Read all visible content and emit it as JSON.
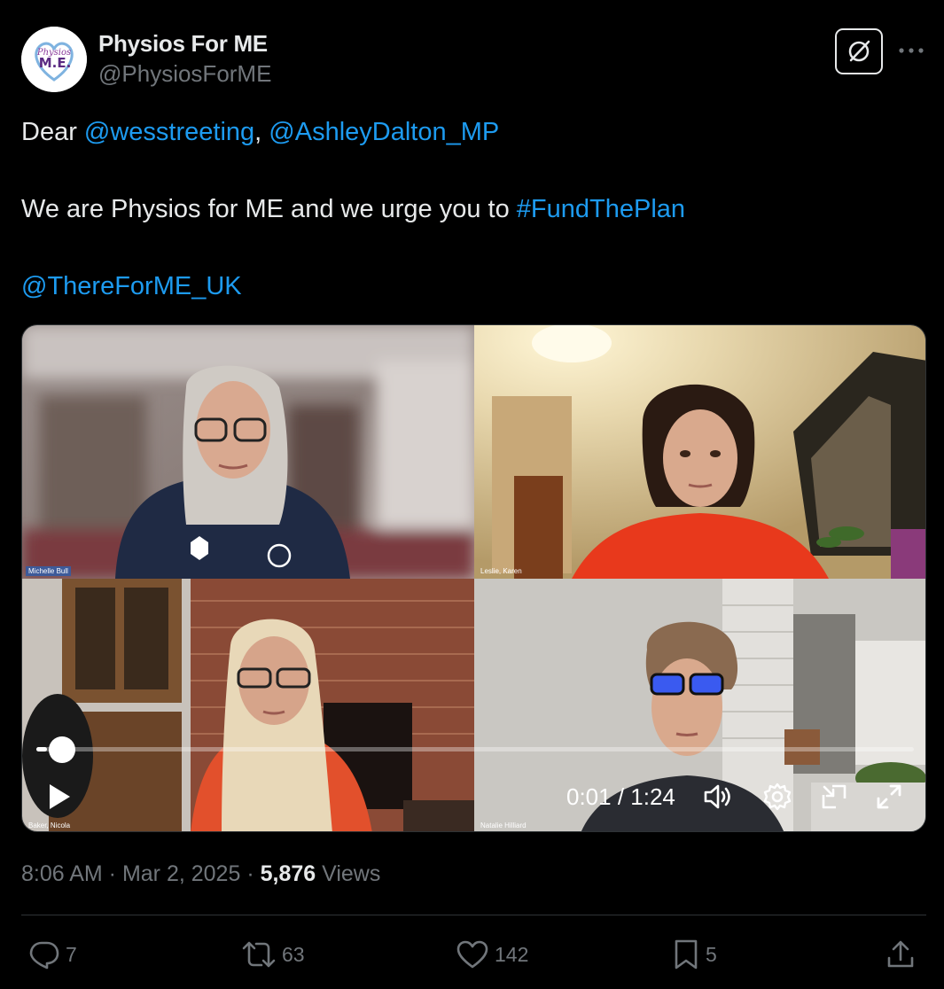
{
  "author": {
    "display_name": "Physios For ME",
    "handle": "@PhysiosForME",
    "avatar_text_top": "Physios",
    "avatar_text_main": "M.E."
  },
  "tweet": {
    "line1_prefix": "Dear ",
    "mention1": "@wesstreeting",
    "line1_sep": ", ",
    "mention2": "@AshleyDalton_MP",
    "line2_prefix": "We are Physios for ME and we urge you to ",
    "hashtag": "#FundThePlan",
    "mention3": "@ThereForME_UK"
  },
  "video": {
    "participants": [
      {
        "name": "Michelle Bull"
      },
      {
        "name": "Leslie, Karen"
      },
      {
        "name": "Baker, Nicola"
      },
      {
        "name": "Natalie Hilliard"
      }
    ],
    "time_display": "0:01 / 1:24",
    "progress": 0.012,
    "icons": [
      "play-icon",
      "volume-icon",
      "settings-icon",
      "pip-icon",
      "fullscreen-icon"
    ]
  },
  "meta": {
    "time": "8:06 AM",
    "separator": " · ",
    "date": "Mar 2, 2025",
    "views_count": "5,876",
    "views_label": " Views"
  },
  "actions": {
    "replies": "7",
    "reposts": "63",
    "likes": "142",
    "bookmarks": "5"
  },
  "colors": {
    "background": "#000000",
    "text": "#e7e9ea",
    "secondary": "#71767b",
    "link": "#1d9bf0",
    "divider": "#2f3336"
  }
}
